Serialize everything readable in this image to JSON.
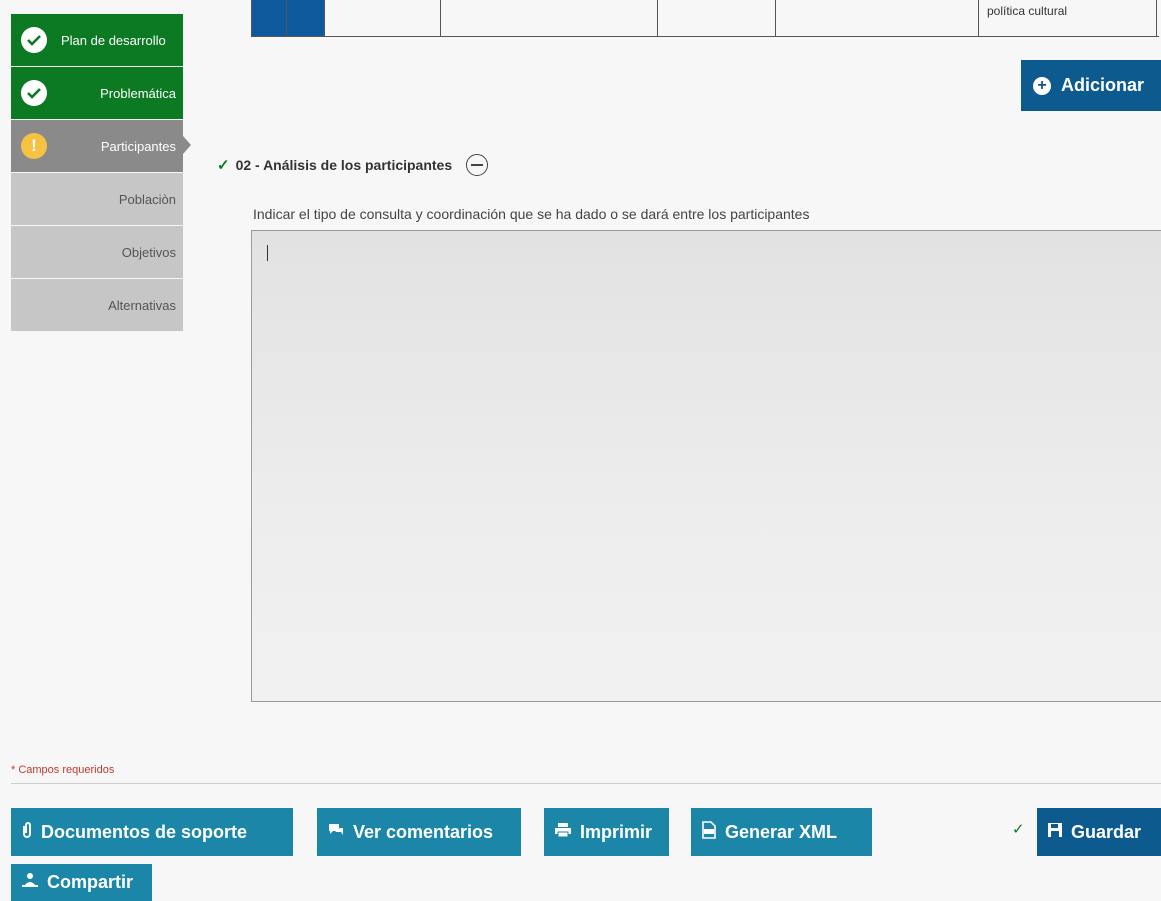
{
  "sidebar": {
    "items": [
      {
        "label": "Plan de desarrollo",
        "state": "done"
      },
      {
        "label": "Problemática",
        "state": "done"
      },
      {
        "label": "Participantes",
        "state": "current"
      },
      {
        "label": "Poblaciòn",
        "state": "pending"
      },
      {
        "label": "Objetivos",
        "state": "pending"
      },
      {
        "label": "Alternativas",
        "state": "pending"
      }
    ],
    "icons": {
      "done": "check-circle-icon",
      "current": "warning-circle-icon"
    }
  },
  "top_table": {
    "last_cell_text": "política cultural"
  },
  "add_button": {
    "label": "Adicionar",
    "icon": "plus-circle-icon"
  },
  "section": {
    "title": "02 - Análisis de los participantes",
    "field_label": "Indicar el tipo de consulta y coordinación que se ha dado o se dará entre los participantes",
    "field_value": ""
  },
  "required_note": "* Campos requeridos",
  "footer": {
    "documentos": "Documentos de soporte",
    "comentarios": "Ver comentarios",
    "imprimir": "Imprimir",
    "xml": "Generar XML",
    "guardar": "Guardar",
    "compartir": "Compartir"
  },
  "colors": {
    "done_green": "#0b7a22",
    "current_gray": "#8a8a8a",
    "pending_gray": "#c6c6c6",
    "primary_blue": "#0d5a8f",
    "teal": "#1b86a8",
    "required_red": "#c0392b"
  }
}
